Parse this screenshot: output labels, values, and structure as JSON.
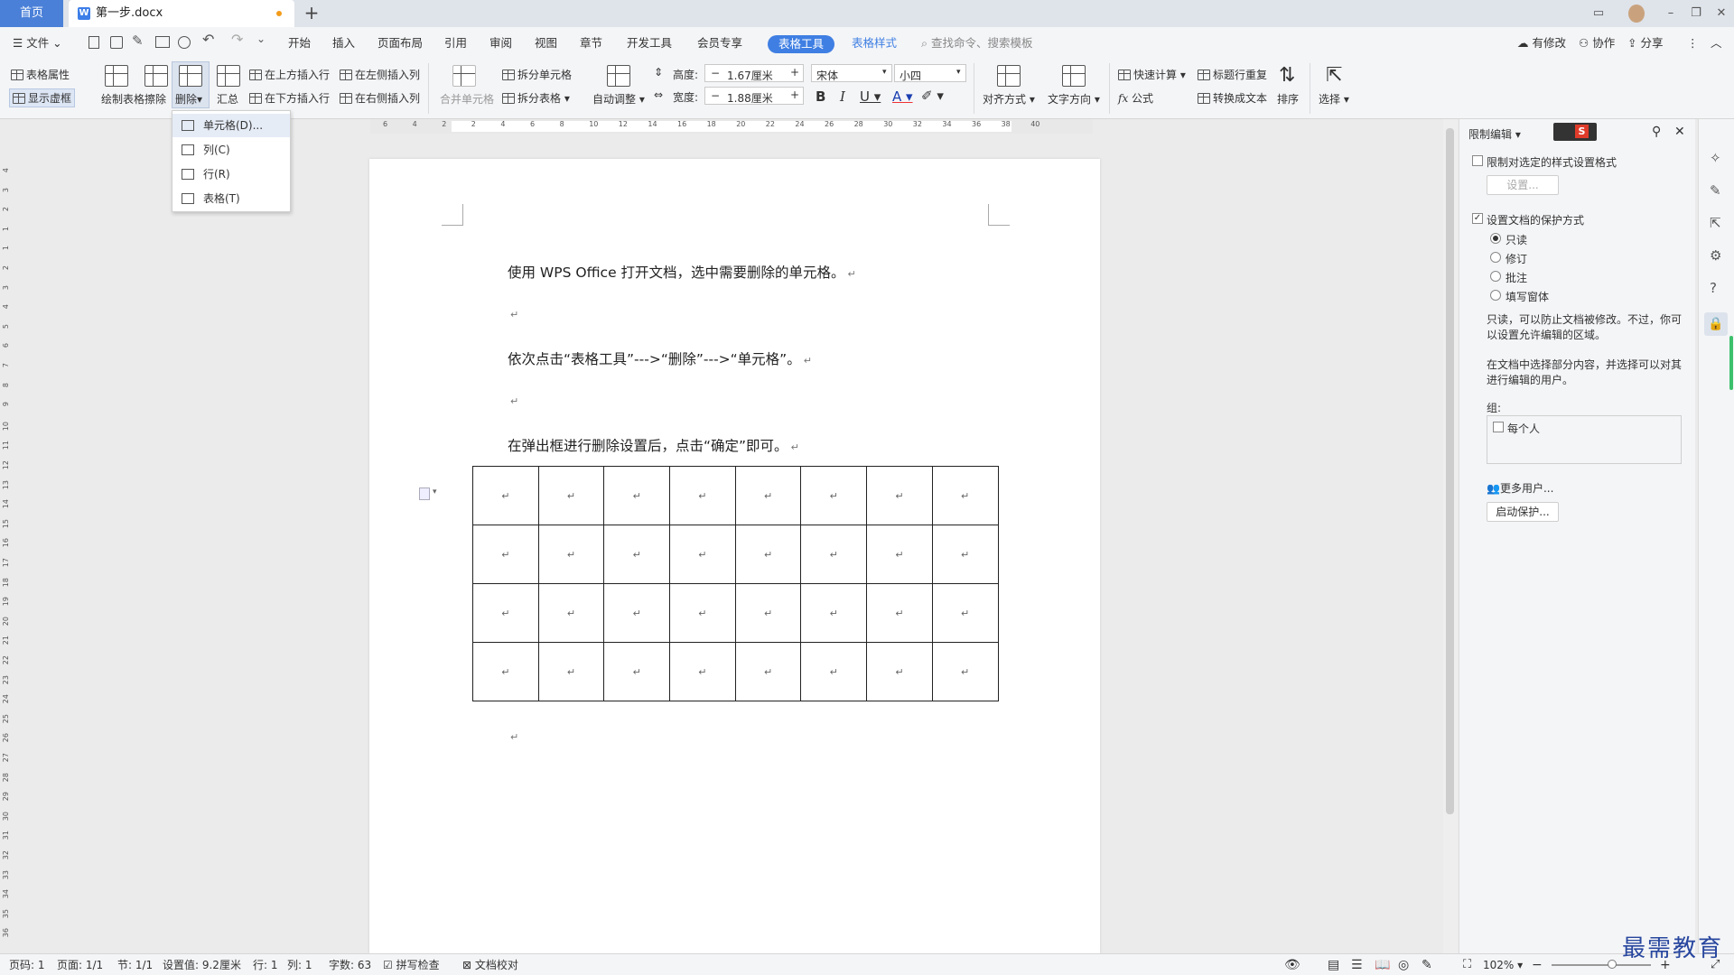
{
  "titlebar": {
    "home_tab": "首页",
    "doc_tab": "第一步.docx",
    "new_tab": "+"
  },
  "menu": {
    "file": "文件",
    "items": [
      "开始",
      "插入",
      "页面布局",
      "引用",
      "审阅",
      "视图",
      "章节",
      "开发工具",
      "会员专享"
    ],
    "active": "表格工具",
    "table_style": "表格样式",
    "search": "查找命令、搜索模板",
    "modified": "有修改",
    "collab": "协作",
    "share": "分享"
  },
  "ribbon": {
    "table_props": "表格属性",
    "show_gridlines": "显示虚框",
    "draw_table": "绘制表格",
    "erase": "擦除",
    "delete": "删除",
    "summary": "汇总",
    "insert_above": "在上方插入行",
    "insert_below": "在下方插入行",
    "insert_left": "在左侧插入列",
    "insert_right": "在右侧插入列",
    "merge_cells": "合并单元格",
    "split_cells": "拆分单元格",
    "split_table": "拆分表格",
    "auto_fit": "自动调整",
    "height_label": "高度:",
    "height_value": "1.67厘米",
    "width_label": "宽度:",
    "width_value": "1.88厘米",
    "font_name": "宋体",
    "font_size": "小四",
    "align": "对齐方式",
    "text_dir": "文字方向",
    "quick_calc": "快速计算",
    "formula": "公式",
    "title_repeat": "标题行重复",
    "to_text": "转换成文本",
    "sort": "排序",
    "select": "选择"
  },
  "delete_menu": {
    "items": [
      "单元格(D)...",
      "列(C)",
      "行(R)",
      "表格(T)"
    ]
  },
  "ruler": {
    "h_ticks": [
      "6",
      "4",
      "2",
      "2",
      "4",
      "6",
      "8",
      "10",
      "12",
      "14",
      "16",
      "18",
      "20",
      "22",
      "24",
      "26",
      "28",
      "30",
      "32",
      "34",
      "36",
      "38",
      "40"
    ],
    "v_ticks": [
      "4",
      "3",
      "2",
      "1",
      "1",
      "2",
      "3",
      "4",
      "5",
      "6",
      "7",
      "8",
      "9",
      "10",
      "11",
      "12",
      "13",
      "14",
      "15",
      "16",
      "17",
      "18",
      "19",
      "20",
      "21",
      "22",
      "23",
      "24",
      "25",
      "26",
      "27",
      "28",
      "29",
      "30",
      "31",
      "32",
      "33",
      "34",
      "35",
      "36"
    ]
  },
  "doc": {
    "p1": "使用 WPS Office 打开文档，选中需要删除的单元格。",
    "p2": "依次点击“表格工具”--->“删除”--->“单元格”。",
    "p3": "在弹出框进行删除设置后，点击“确定”即可。",
    "mark": "↵",
    "rows": 4,
    "cols": 8
  },
  "panel": {
    "title": "限制编辑",
    "restrict_format": "限制对选定的样式设置格式",
    "settings_btn": "设置...",
    "protect_method": "设置文档的保护方式",
    "options": [
      "只读",
      "修订",
      "批注",
      "填写窗体"
    ],
    "desc1": "只读，可以防止文档被修改。不过，你可以设置允许编辑的区域。",
    "desc2": "在文档中选择部分内容，并选择可以对其进行编辑的用户。",
    "group_label": "组:",
    "everyone": "每个人",
    "more_users": "更多用户...",
    "start_protect": "启动保护..."
  },
  "status": {
    "page_code": "页码: 1",
    "page": "页面: 1/1",
    "section": "节: 1/1",
    "setting": "设置值: 9.2厘米",
    "row": "行: 1",
    "col": "列: 1",
    "words": "字数: 63",
    "spell": "拼写检查",
    "proof": "文档校对",
    "zoom": "102%"
  },
  "watermark": "最需教育"
}
